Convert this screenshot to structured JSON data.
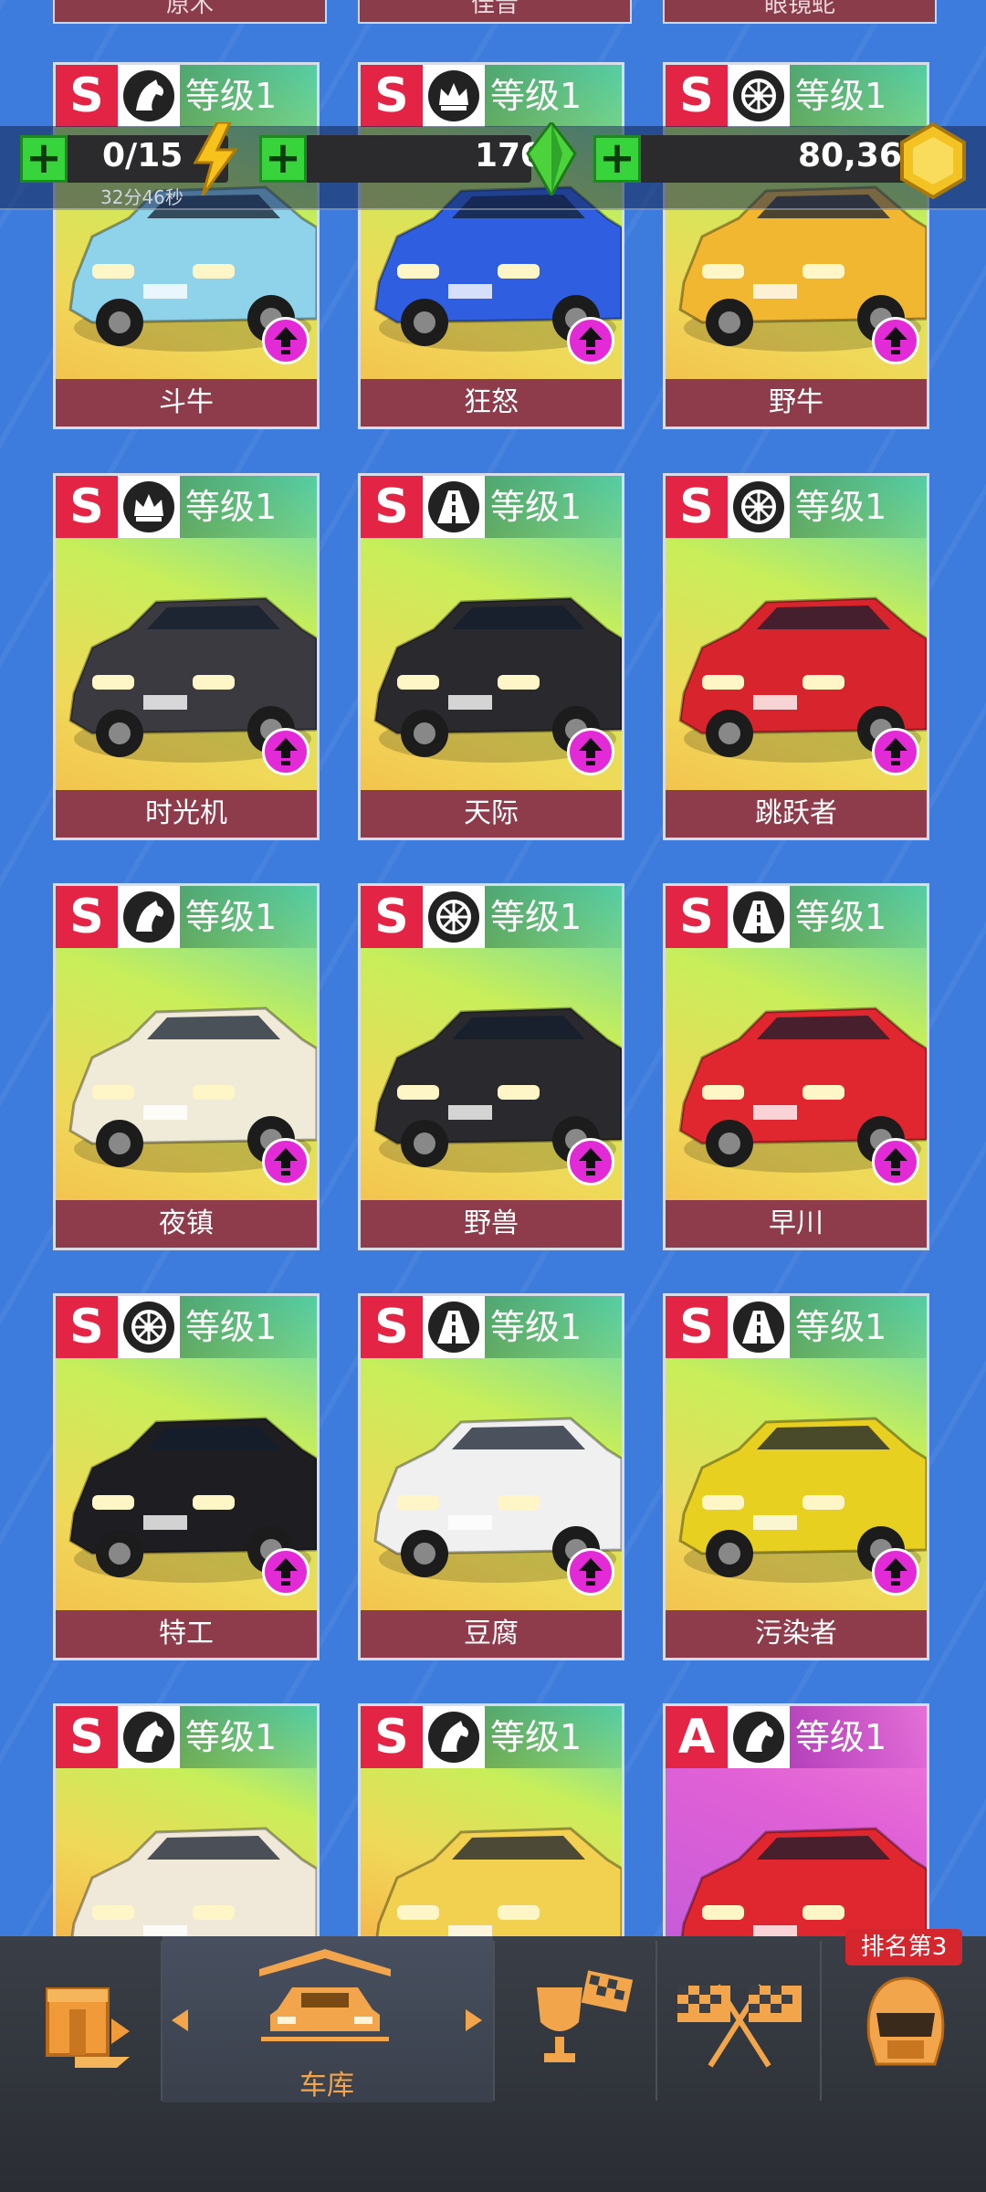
{
  "top_partial_cards": [
    "原木",
    "佳音",
    "眼镜蛇"
  ],
  "resources": {
    "energy": {
      "value": "0/15",
      "timer": "32分46秒",
      "icon": "lightning-icon"
    },
    "gems": {
      "value": "170",
      "icon": "green-gem-icon"
    },
    "coins": {
      "value": "80,369",
      "icon": "gold-coin-icon"
    }
  },
  "cards": [
    {
      "grade": "S",
      "type_icon": "horse-icon",
      "level": "等级1",
      "name": "斗牛",
      "theme": "green"
    },
    {
      "grade": "S",
      "type_icon": "crown-icon",
      "level": "等级1",
      "name": "狂怒",
      "theme": "green"
    },
    {
      "grade": "S",
      "type_icon": "wheel-icon",
      "level": "等级1",
      "name": "野牛",
      "theme": "green"
    },
    {
      "grade": "S",
      "type_icon": "crown-icon",
      "level": "等级1",
      "name": "时光机",
      "theme": "green"
    },
    {
      "grade": "S",
      "type_icon": "road-icon",
      "level": "等级1",
      "name": "天际",
      "theme": "green"
    },
    {
      "grade": "S",
      "type_icon": "wheel-icon",
      "level": "等级1",
      "name": "跳跃者",
      "theme": "green"
    },
    {
      "grade": "S",
      "type_icon": "horse-icon",
      "level": "等级1",
      "name": "夜镇",
      "theme": "green"
    },
    {
      "grade": "S",
      "type_icon": "wheel-icon",
      "level": "等级1",
      "name": "野兽",
      "theme": "green"
    },
    {
      "grade": "S",
      "type_icon": "road-icon",
      "level": "等级1",
      "name": "早川",
      "theme": "green"
    },
    {
      "grade": "S",
      "type_icon": "wheel-icon",
      "level": "等级1",
      "name": "特工",
      "theme": "green"
    },
    {
      "grade": "S",
      "type_icon": "road-icon",
      "level": "等级1",
      "name": "豆腐",
      "theme": "green"
    },
    {
      "grade": "S",
      "type_icon": "road-icon",
      "level": "等级1",
      "name": "污染者",
      "theme": "green"
    },
    {
      "grade": "S",
      "type_icon": "horse-icon",
      "level": "等级1",
      "name": "",
      "theme": "green"
    },
    {
      "grade": "S",
      "type_icon": "horse-icon",
      "level": "等级1",
      "name": "",
      "theme": "green"
    },
    {
      "grade": "A",
      "type_icon": "horse-icon",
      "level": "等级1",
      "name": "",
      "theme": "purple"
    }
  ],
  "car_colors": [
    "#8fd3ea",
    "#2f5fe0",
    "#f2b730",
    "#3a3a40",
    "#2a2a2e",
    "#d8242c",
    "#f0ead8",
    "#2a2a2e",
    "#e0262e",
    "#1e1e22",
    "#f0f0f0",
    "#e8d020",
    "#f0e8d8",
    "#f2d050",
    "#e0262e"
  ],
  "nav": {
    "shop_icon": "crate-icon",
    "garage_label": "车库",
    "garage_icon": "car-garage-icon",
    "trophy_icon": "trophy-icon",
    "race_icon": "checkered-flags-icon",
    "profile_icon": "helmet-icon",
    "rank_badge": "排名第3"
  }
}
